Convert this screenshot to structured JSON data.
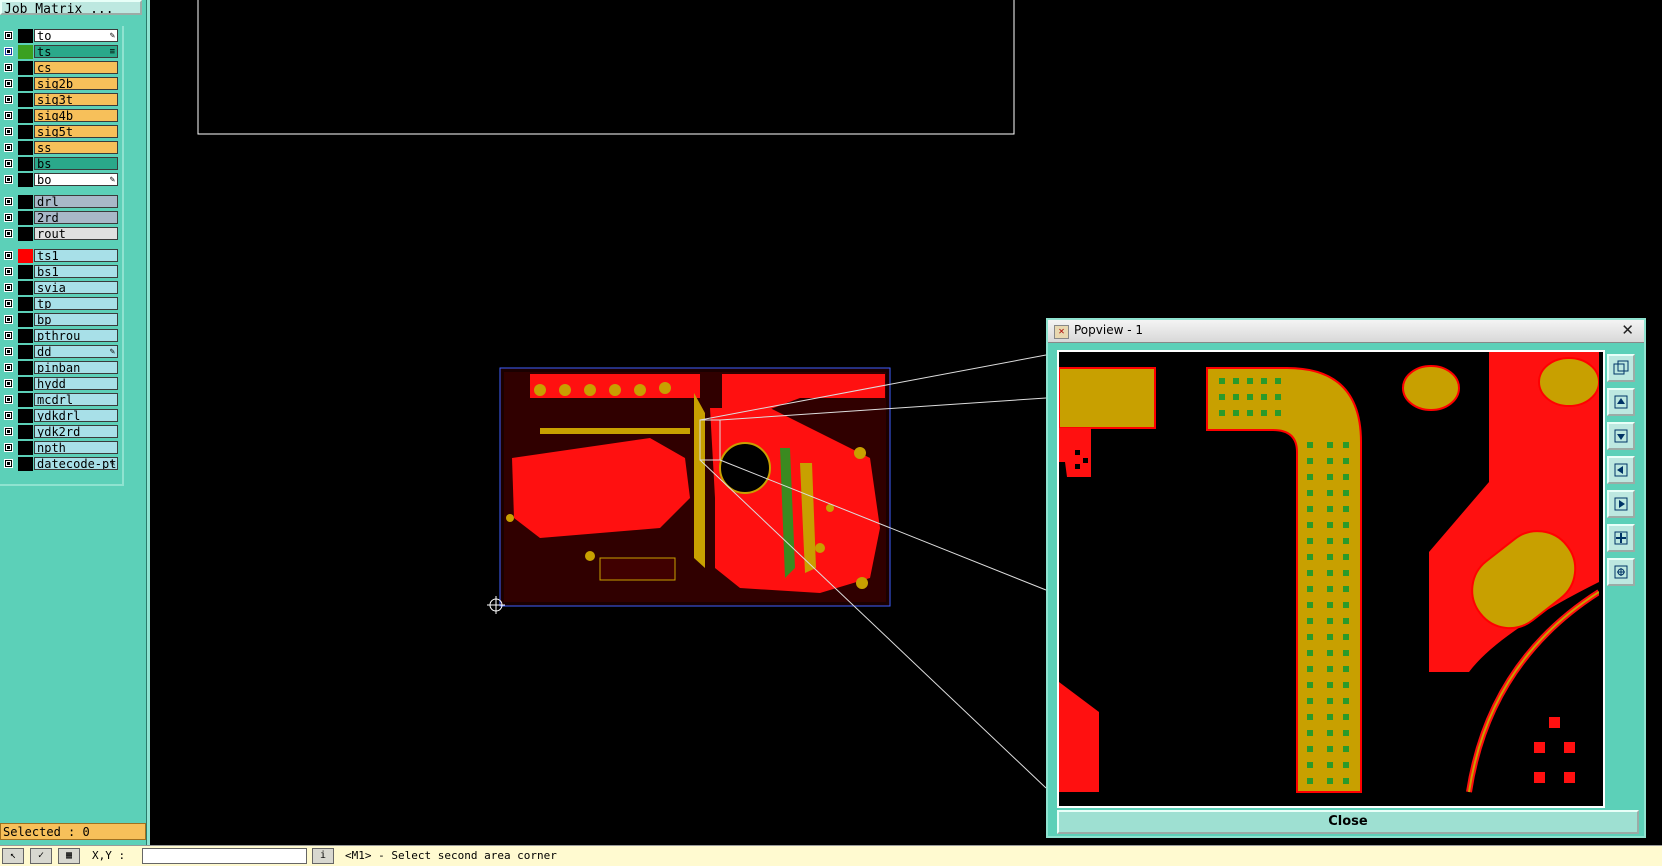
{
  "title_button": "Job Matrix ...",
  "layers": [
    {
      "name": "to",
      "bg": "#ffffff",
      "swatch": "#000000",
      "mark": "✎"
    },
    {
      "name": "ts",
      "bg": "#2aa88a",
      "swatch": "#3aa020",
      "checked": true,
      "mark": "≡"
    },
    {
      "name": "cs",
      "bg": "#f7c05a",
      "swatch": "#000000"
    },
    {
      "name": "sig2b",
      "bg": "#f7c05a",
      "swatch": "#000000"
    },
    {
      "name": "sig3t",
      "bg": "#f7c05a",
      "swatch": "#000000"
    },
    {
      "name": "sig4b",
      "bg": "#f7c05a",
      "swatch": "#000000"
    },
    {
      "name": "sig5t",
      "bg": "#f7c05a",
      "swatch": "#000000"
    },
    {
      "name": "ss",
      "bg": "#f7c05a",
      "swatch": "#000000"
    },
    {
      "name": "bs",
      "bg": "#2aa88a",
      "swatch": "#000000"
    },
    {
      "name": "bo",
      "bg": "#ffffff",
      "swatch": "#000000",
      "mark": "✎"
    },
    {
      "name": "drl",
      "bg": "#a8b8c8",
      "swatch": "#000000"
    },
    {
      "name": "2rd",
      "bg": "#a8b8c8",
      "swatch": "#000000"
    },
    {
      "name": "rout",
      "bg": "#e0e0e0",
      "swatch": "#000000"
    },
    {
      "name": "ts1",
      "bg": "#a8e0e8",
      "swatch": "#ff0000"
    },
    {
      "name": "bs1",
      "bg": "#a8e0e8",
      "swatch": "#000000"
    },
    {
      "name": "svia",
      "bg": "#a8e0e8",
      "swatch": "#000000"
    },
    {
      "name": "tp",
      "bg": "#a8e0e8",
      "swatch": "#000000"
    },
    {
      "name": "bp",
      "bg": "#a8e0e8",
      "swatch": "#000000"
    },
    {
      "name": "pthrou",
      "bg": "#a8e0e8",
      "swatch": "#000000"
    },
    {
      "name": "dd",
      "bg": "#a8e0e8",
      "swatch": "#000000",
      "mark": "✎"
    },
    {
      "name": "pinban",
      "bg": "#a8e0e8",
      "swatch": "#000000"
    },
    {
      "name": "hydd",
      "bg": "#a8e0e8",
      "swatch": "#000000"
    },
    {
      "name": "mcdrl",
      "bg": "#a8e0e8",
      "swatch": "#000000"
    },
    {
      "name": "ydkdrl",
      "bg": "#a8e0e8",
      "swatch": "#000000"
    },
    {
      "name": "ydk2rd",
      "bg": "#a8e0e8",
      "swatch": "#000000"
    },
    {
      "name": "npth",
      "bg": "#a8e0e8",
      "swatch": "#000000"
    },
    {
      "name": "datecode-pt",
      "bg": "#a8e0e8",
      "swatch": "#000000",
      "mark": "✎"
    }
  ],
  "status": {
    "selected": "Selected : 0"
  },
  "bottom": {
    "xy_label": "X,Y :",
    "xy_value": "",
    "prompt": "<M1> - Select second area corner"
  },
  "popview": {
    "title": "Popview - 1",
    "close_label": "Close",
    "close_x": "✕"
  },
  "colors": {
    "panel": "#5cd0b8",
    "copper": "#ff0000",
    "gold": "#c8a000",
    "board_bg": "#000000"
  }
}
